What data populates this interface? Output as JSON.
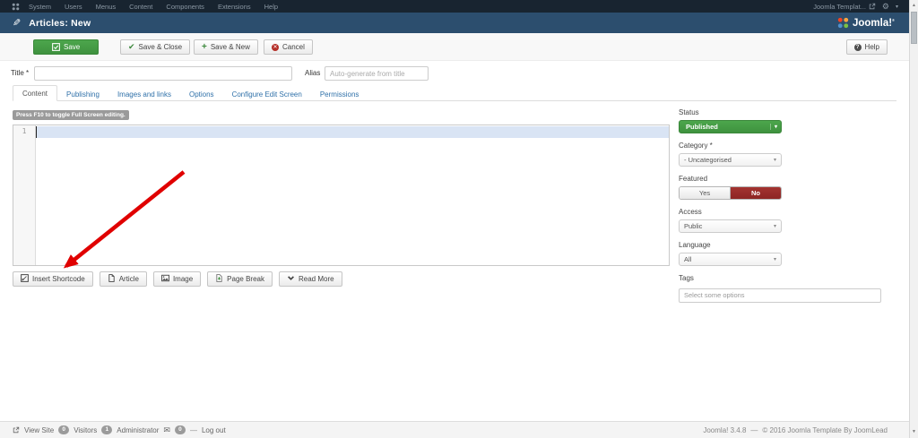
{
  "admin_bar": {
    "menus": [
      "System",
      "Users",
      "Menus",
      "Content",
      "Components",
      "Extensions",
      "Help"
    ],
    "template_link": "Joomla Templat..."
  },
  "header": {
    "page_title": "Articles: New",
    "logo_text": "Joomla!",
    "logo_mark": "®"
  },
  "toolbar": {
    "save": "Save",
    "save_close": "Save & Close",
    "save_new": "Save & New",
    "cancel": "Cancel",
    "help": "Help"
  },
  "form": {
    "title_label": "Title *",
    "title_value": "",
    "alias_label": "Alias",
    "alias_placeholder": "Auto-generate from title"
  },
  "tabs": [
    {
      "label": "Content",
      "active": true
    },
    {
      "label": "Publishing",
      "active": false
    },
    {
      "label": "Images and links",
      "active": false
    },
    {
      "label": "Options",
      "active": false
    },
    {
      "label": "Configure Edit Screen",
      "active": false
    },
    {
      "label": "Permissions",
      "active": false
    }
  ],
  "editor": {
    "hint": "Press F10 to toggle Full Screen editing.",
    "line_number": "1",
    "buttons": [
      {
        "label": "Insert Shortcode",
        "icon": "shortcode"
      },
      {
        "label": "Article",
        "icon": "article"
      },
      {
        "label": "Image",
        "icon": "image"
      },
      {
        "label": "Page Break",
        "icon": "pagebreak"
      },
      {
        "label": "Read More",
        "icon": "readmore"
      }
    ]
  },
  "sidebar": {
    "status": {
      "label": "Status",
      "value": "Published"
    },
    "category": {
      "label": "Category *",
      "value": "- Uncategorised"
    },
    "featured": {
      "label": "Featured",
      "yes": "Yes",
      "no": "No",
      "selected": "No"
    },
    "access": {
      "label": "Access",
      "value": "Public"
    },
    "language": {
      "label": "Language",
      "value": "All"
    },
    "tags": {
      "label": "Tags",
      "placeholder": "Select some options"
    }
  },
  "status_bar": {
    "view_site": "View Site",
    "visitors_count": "0",
    "visitors_label": "Visitors",
    "admin_count": "1",
    "admin_label": "Administrator",
    "messages_count": "0",
    "logout": "Log out",
    "version": "Joomla! 3.4.8",
    "separator": "—",
    "copyright": "© 2016 Joomla Template By JoomLead"
  },
  "colors": {
    "topbar": "#182430",
    "header": "#2c4e6e",
    "green": "#46a546",
    "red_no": "#9b2d2b",
    "link_blue": "#3071a9",
    "arrow_red": "#e00000",
    "active_line": "#d9e4f4"
  }
}
